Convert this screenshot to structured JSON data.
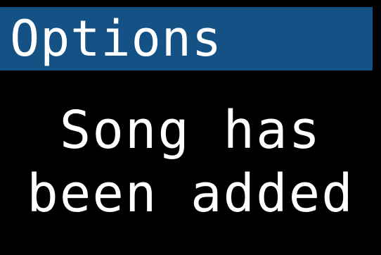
{
  "header": {
    "title": "Options",
    "background_color": "#145285"
  },
  "dialog": {
    "message_lines": [
      "Song has",
      "been added"
    ],
    "text_color": "#ffffff",
    "background_color": "#000000"
  }
}
